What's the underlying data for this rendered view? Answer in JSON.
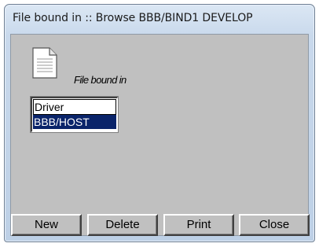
{
  "window": {
    "title": "File bound in :: Browse BBB/BIND1 DEVELOP"
  },
  "content": {
    "icon": "document-icon",
    "label": "File bound in",
    "list": {
      "header": "Driver",
      "selected_item": "BBB/HOST"
    }
  },
  "buttons": {
    "new_label": "New",
    "delete_label": "Delete",
    "print_label": "Print",
    "close_label": "Close"
  }
}
